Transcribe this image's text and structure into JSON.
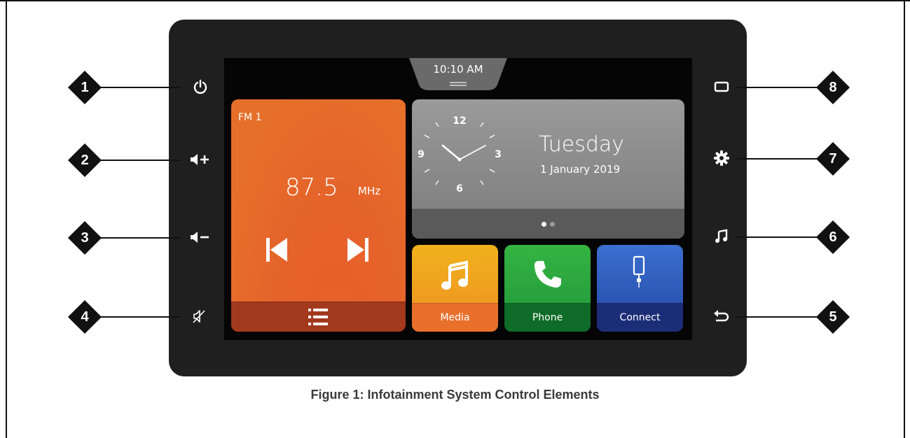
{
  "screen": {
    "time": "10:10 AM",
    "radio": {
      "band": "FM 1",
      "frequency": "87.5",
      "unit": "MHz"
    },
    "date": {
      "day": "Tuesday",
      "full_date": "1 January 2019",
      "clock_numbers": [
        "12",
        "3",
        "6",
        "9"
      ],
      "page_dots": 2,
      "active_dot": 1
    },
    "apps": [
      {
        "label": "Media",
        "icon": "music-note-icon"
      },
      {
        "label": "Phone",
        "icon": "phone-icon"
      },
      {
        "label": "Connect",
        "icon": "smartphone-icon"
      }
    ]
  },
  "left_buttons": [
    {
      "callout": "1",
      "icon": "power-icon"
    },
    {
      "callout": "2",
      "icon": "volume-up-icon"
    },
    {
      "callout": "3",
      "icon": "volume-down-icon"
    },
    {
      "callout": "4",
      "icon": "mute-icon"
    }
  ],
  "right_buttons": [
    {
      "callout": "8",
      "icon": "display-icon"
    },
    {
      "callout": "7",
      "icon": "gear-icon"
    },
    {
      "callout": "6",
      "icon": "music-note-icon"
    },
    {
      "callout": "5",
      "icon": "back-icon"
    }
  ],
  "caption": "Figure 1: Infotainment System Control Elements",
  "colors": {
    "radio": "#e46a28",
    "media": "#f2a21b",
    "phone": "#1f9a3e",
    "connect": "#2a55b0"
  }
}
